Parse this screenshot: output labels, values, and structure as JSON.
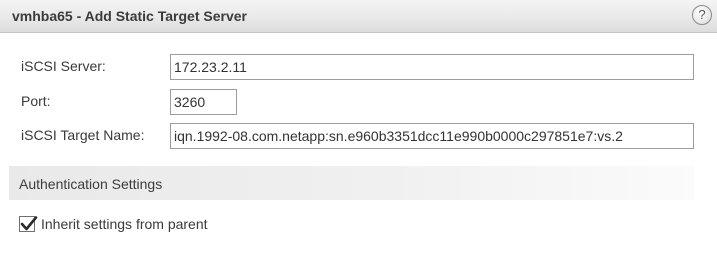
{
  "dialog": {
    "title": "vmhba65 - Add Static Target Server",
    "help_icon": "help-icon",
    "help_glyph": "?"
  },
  "form": {
    "iscsi_server": {
      "label": "iSCSI Server:",
      "value": "172.23.2.11"
    },
    "port": {
      "label": "Port:",
      "value": "3260"
    },
    "target_name": {
      "label": "iSCSI Target Name:",
      "value": "iqn.1992-08.com.netapp:sn.e960b3351dcc11e990b0000c297851e7:vs.2"
    }
  },
  "authentication": {
    "section_title": "Authentication Settings",
    "inherit_label": "Inherit settings from parent",
    "inherit_checked": true,
    "check_icon": "checkmark-icon"
  }
}
